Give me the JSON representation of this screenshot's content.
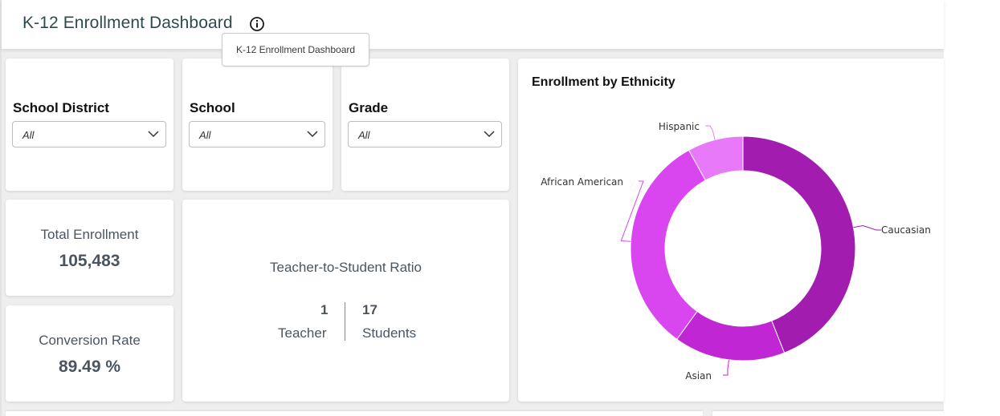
{
  "header": {
    "title": "K-12 Enrollment Dashboard",
    "tooltip": "K-12 Enrollment Dashboard",
    "info_icon": "info-circle-icon"
  },
  "filters": [
    {
      "label": "School District",
      "value": "All"
    },
    {
      "label": "School",
      "value": "All"
    },
    {
      "label": "Grade",
      "value": "All"
    }
  ],
  "kpis": {
    "total_enrollment": {
      "label": "Total Enrollment",
      "value": "105,483"
    },
    "conversion_rate": {
      "label": "Conversion Rate",
      "value": "89.49 %"
    }
  },
  "ratio": {
    "title": "Teacher-to-Student Ratio",
    "teacher_count": "1",
    "teacher_label": "Teacher",
    "student_count": "17",
    "student_label": "Students"
  },
  "chart_data": {
    "type": "pie",
    "title": "Enrollment by Ethnicity",
    "donut": true,
    "categories": [
      "Caucasian",
      "Asian",
      "African American",
      "Hispanic"
    ],
    "values": [
      44,
      16,
      32,
      8
    ],
    "colors": [
      "#a21caf",
      "#c026d3",
      "#d946ef",
      "#e879f9"
    ]
  }
}
